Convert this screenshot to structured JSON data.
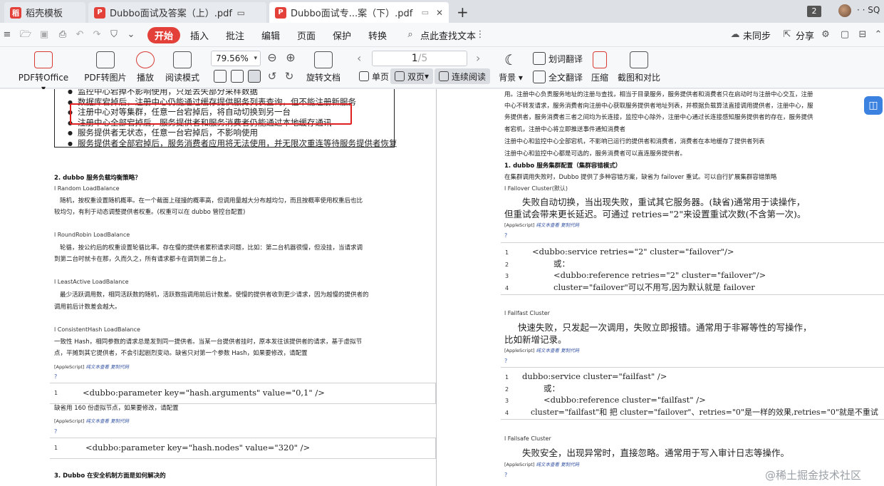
{
  "tabs": [
    {
      "label": "稻壳模板",
      "icon": "docer-icon",
      "color": "#e3403a"
    },
    {
      "label": "Dubbo面试及答案（上）.pdf",
      "icon": "pdf-icon",
      "color": "#e3403a"
    },
    {
      "label": "Dubbo面试专...案（下）.pdf",
      "icon": "pdf-icon",
      "color": "#e3403a"
    }
  ],
  "window": {
    "count_badge": "2",
    "user": "SQ"
  },
  "menu": {
    "start": "开始",
    "insert": "插入",
    "annotate": "批注",
    "edit": "编辑",
    "page": "页面",
    "protect": "保护",
    "convert": "转换",
    "search": "点此查找文本",
    "sync": "未同步",
    "share": "分享"
  },
  "ribbon": {
    "pdf_to_office": "PDF转Office",
    "pdf_to_image": "PDF转图片",
    "play": "播放",
    "read_mode": "阅读模式",
    "zoom": "79.56%",
    "rotate": "旋转文档",
    "page_current": "1",
    "page_total": "/5",
    "single": "单页",
    "double": "双页",
    "continuous": "连续阅读",
    "background": "背景",
    "word_translate": "划词翻译",
    "full_translate": "全文翻译",
    "compress": "压缩",
    "screenshot": "截图和对比"
  },
  "left": {
    "bullets": [
      "监控中心宕掉不影响使用，只是丢失部分采样数据",
      "数据库宕掉后，注册中心仍能通过缓存提供服务列表查询，但不能注册新服务",
      "注册中心对等集群，任意一台宕掉后，将自动切换到另一台",
      "注册中心全部宕掉后，服务提供者和服务消费者仍能通过本地缓存通讯",
      "服务提供者无状态，任意一台宕掉后，不影响使用",
      "服务提供者全部宕掉后，服务消费者应用将无法使用，并无限次重连等待服务提供者恢复"
    ],
    "q2": "2. dubbo 服务负载均衡策略？",
    "random_title": "l Random LoadBalance",
    "random_l1": "随机，按权重设置随机概率。在一个截面上碰撞的概率高，但调用量越大分布越均匀，而且按概率使用权重后也比",
    "random_l2": "较均匀，有利于动态调整提供者权重。(权重可以在 dubbo 管控台配置)",
    "rr_title": "l RoundRobin LoadBalance",
    "rr_l1": "轮循，按公约后的权重设置轮循比率。存在慢的提供者累积请求问题，比如：第二台机器很慢，但没挂，当请求调",
    "rr_l2": "到第二台时就卡在那，久而久之，所有请求都卡在调到第二台上。",
    "la_title": "l LeastActive LoadBalance",
    "la_l1": "最少活跃调用数，相同活跃数的随机，活跃数指调用前后计数差。使慢的提供者收到更少请求，因为越慢的提供者的",
    "la_l2": "调用前后计数差会越大。",
    "ch_title": "l ConsistentHash LoadBalance",
    "ch_l1": "一致性 Hash，相同参数的请求总是发到同一提供者。当某一台提供者挂时，原本发往该提供者的请求，基于虚拟节",
    "ch_l2": "点，平摊到其它提供者，不会引起剧烈变动。缺省只对第一个参数 Hash，如果要修改，请配置",
    "tag_prefix": "[AppleScript]",
    "tag_links": "纯文本查看  复制代码",
    "q_mark": "?",
    "code1_ln": "1",
    "code1": "<dubbo:parameter key=\"hash.arguments\"  value=\"0,1\" />",
    "nodes_note": "缺省用 160 份虚拟节点，如果要修改，请配置",
    "code2_ln": "1",
    "code2": "<dubbo:parameter key=\"hash.nodes\" value=\"320\" />",
    "q3": "3. Dubbo 在安全机制方面是如何解决的"
  },
  "right": {
    "p1": "用。注册中心负责服务地址的注册与查找，相当于目录服务，服务提供者和消费者只在启动时与注册中心交互，注册",
    "p2": "中心不转发请求，服务消费者向注册中心获取服务提供者地址列表，并根据负载算法直接调用提供者，注册中心，服",
    "p3": "务提供者，服务消费者三者之间均为长连接，监控中心除外，注册中心通过长连接感知服务提供者的存在，服务提供",
    "p4": "者宕机，注册中心将立即推送事件通知消费者",
    "p5": "注册中心和监控中心全部宕机，不影响已运行的提供者和消费者，消费者在本地缓存了提供者列表",
    "p6": "注册中心和监控中心都是可选的，服务消费者可以直连服务提供者。",
    "q1": "1. dubbo 服务集群配置（集群容错模式）",
    "q1_note": "在集群调用失败时，Dubbo 提供了多种容错方案，缺省为 failover 重试。可以自行扩展集群容错策略",
    "fo_title": "l Failover Cluster(默认)",
    "fo_l1": "失败自动切换，当出现失败，重试其它服务器。(缺省)通常用于读操作，",
    "fo_l2": "但重试会带来更长延迟。可通过 retries=\"2\"来设置重试次数(不含第一次)。",
    "tag_prefix": "[AppleScript]",
    "tag_links": "纯文本查看  复制代码",
    "q_mark": "?",
    "fo_code": [
      {
        "ln": "1",
        "text": "<dubbo:service retries=\"2\" cluster=\"failover\"/>"
      },
      {
        "ln": "2",
        "text": "或："
      },
      {
        "ln": "3",
        "text": "<dubbo:reference retries=\"2\" cluster=\"failover\"/>"
      },
      {
        "ln": "4",
        "text": "cluster=\"failover\"可以不用写,因为默认就是 failover"
      }
    ],
    "ff_title": "l Failfast Cluster",
    "ff_l1": "快速失败，只发起一次调用，失败立即报错。通常用于非幂等性的写操作，",
    "ff_l2": "比如新增记录。",
    "ff_code": [
      {
        "ln": "1",
        "text": "dubbo:service cluster=\"failfast\" />"
      },
      {
        "ln": "2",
        "text": "或："
      },
      {
        "ln": "3",
        "text": "<dubbo:reference cluster=\"failfast\" />"
      },
      {
        "ln": "4",
        "text": "cluster=\"failfast\"和 把 cluster=\"failover\"、retries=\"0\"是一样的效果,retries=\"0\"就是不重试"
      }
    ],
    "fs_title": "l Failsafe Cluster",
    "fs_l1": "失败安全，出现异常时，直接忽略。通常用于写入审计日志等操作。"
  },
  "watermark": "@稀土掘金技术社区",
  "colors": {
    "accent": "#e3403a",
    "highlight_box": "#e02020",
    "link": "#3050a0"
  }
}
